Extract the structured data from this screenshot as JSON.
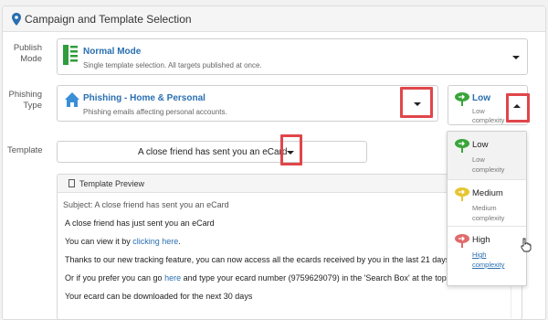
{
  "panel": {
    "title": "Campaign and Template Selection"
  },
  "publish_mode": {
    "label": "Publish Mode",
    "selected_title": "Normal Mode",
    "selected_desc": "Single template selection. All targets published at once."
  },
  "phishing_type": {
    "label": "Phishing Type",
    "selected_title": "Phishing - Home & Personal",
    "selected_desc": "Phishing emails affecting personal accounts."
  },
  "complexity": {
    "selected_name": "Low",
    "selected_desc": "Low complexity",
    "options": [
      {
        "name": "Low",
        "desc": "Low complexity",
        "color": "#3aa53a"
      },
      {
        "name": "Medium",
        "desc": "Medium complexity",
        "color": "#e6c531"
      },
      {
        "name": "High",
        "desc": "High complexity",
        "color": "#e06b6b"
      }
    ]
  },
  "template": {
    "label": "Template",
    "selected": "A close friend has sent you an eCard"
  },
  "preview": {
    "title": "Template Preview",
    "subject": "Subject: A close friend has sent you an eCard",
    "line1": "A close friend has just sent you an eCard",
    "line2_pre": "You can view it by ",
    "line2_link": "clicking here",
    "line2_post": ".",
    "line3": "Thanks to our new tracking feature, you can now access all the ecards received by you in the last 21 days.",
    "line4_pre": "Or if you prefer you can go ",
    "line4_link": "here",
    "line4_post": " and type your ecard number (9759629079) in the 'Search Box' at the top r",
    "line5": "Your ecard can be downloaded for the next 30 days"
  },
  "colors": {
    "accent": "#2a6fb0",
    "highlight": "#e0464a",
    "book_green": "#3aa53a",
    "home_blue": "#3a8fd6"
  }
}
